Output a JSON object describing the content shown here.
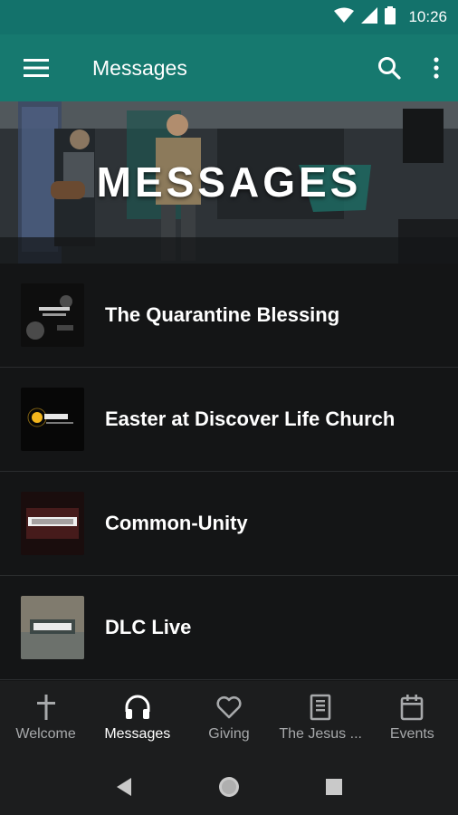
{
  "status_bar": {
    "time": "10:26"
  },
  "app_bar": {
    "title": "Messages"
  },
  "hero": {
    "title": "MESSAGES"
  },
  "messages": [
    {
      "title": "The Quarantine Blessing",
      "thumb": "the-quarantine-blessing-thumbnail"
    },
    {
      "title": "Easter at Discover Life Church",
      "thumb": "easter-thumbnail"
    },
    {
      "title": "Common-Unity",
      "thumb": "common-unity-thumbnail"
    },
    {
      "title": "DLC Live",
      "thumb": "dlc-live-thumbnail"
    }
  ],
  "bottom_nav": [
    {
      "label": "Welcome",
      "icon": "cross-icon"
    },
    {
      "label": "Messages",
      "icon": "headphones-icon",
      "active": true
    },
    {
      "label": "Giving",
      "icon": "heart-icon"
    },
    {
      "label": "The Jesus ...",
      "icon": "bible-icon"
    },
    {
      "label": "Events",
      "icon": "calendar-icon"
    }
  ],
  "colors": {
    "accent": "#16796f",
    "status": "#13726b",
    "background": "#151617"
  }
}
